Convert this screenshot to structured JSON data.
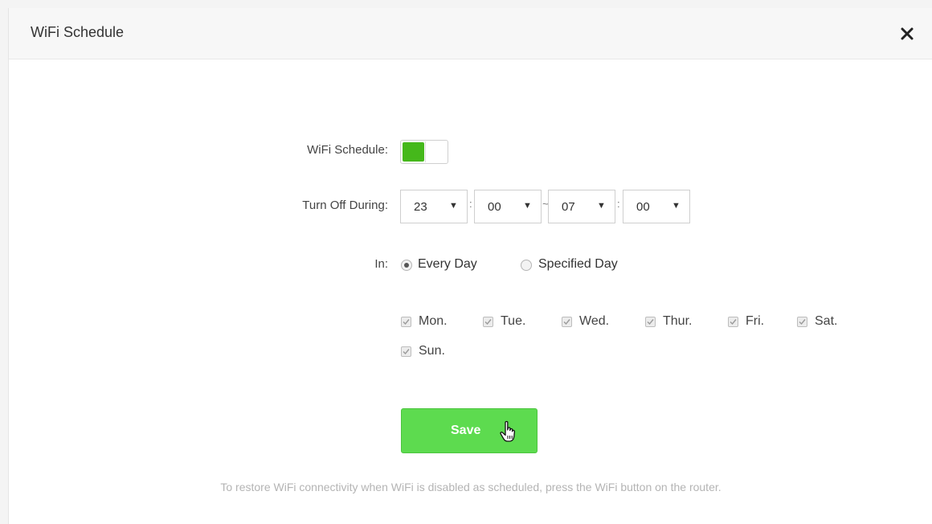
{
  "dialog": {
    "title": "WiFi Schedule",
    "close_icon": "close-icon"
  },
  "form": {
    "schedule_label": "WiFi Schedule:",
    "schedule_enabled": true,
    "turn_off_label": "Turn Off During:",
    "start_hour": "23",
    "start_minute": "00",
    "end_hour": "07",
    "end_minute": "00",
    "colon_separator": ":",
    "range_separator": "~",
    "dropdown_arrow": "▼",
    "in_label": "In:",
    "options": [
      {
        "label": "Every Day",
        "selected": true
      },
      {
        "label": "Specified Day",
        "selected": false
      }
    ],
    "days": [
      {
        "label": "Mon.",
        "checked": true
      },
      {
        "label": "Tue.",
        "checked": true
      },
      {
        "label": "Wed.",
        "checked": true
      },
      {
        "label": "Thur.",
        "checked": true
      },
      {
        "label": "Fri.",
        "checked": true
      },
      {
        "label": "Sat.",
        "checked": true
      },
      {
        "label": "Sun.",
        "checked": true
      }
    ],
    "save_label": "Save"
  },
  "footnote": "To restore WiFi connectivity when WiFi is disabled as scheduled, press the WiFi button on the router.",
  "colors": {
    "toggle_on": "#45b81b",
    "save_button": "#5ddb4f",
    "footnote_text": "#b4b4b4"
  }
}
